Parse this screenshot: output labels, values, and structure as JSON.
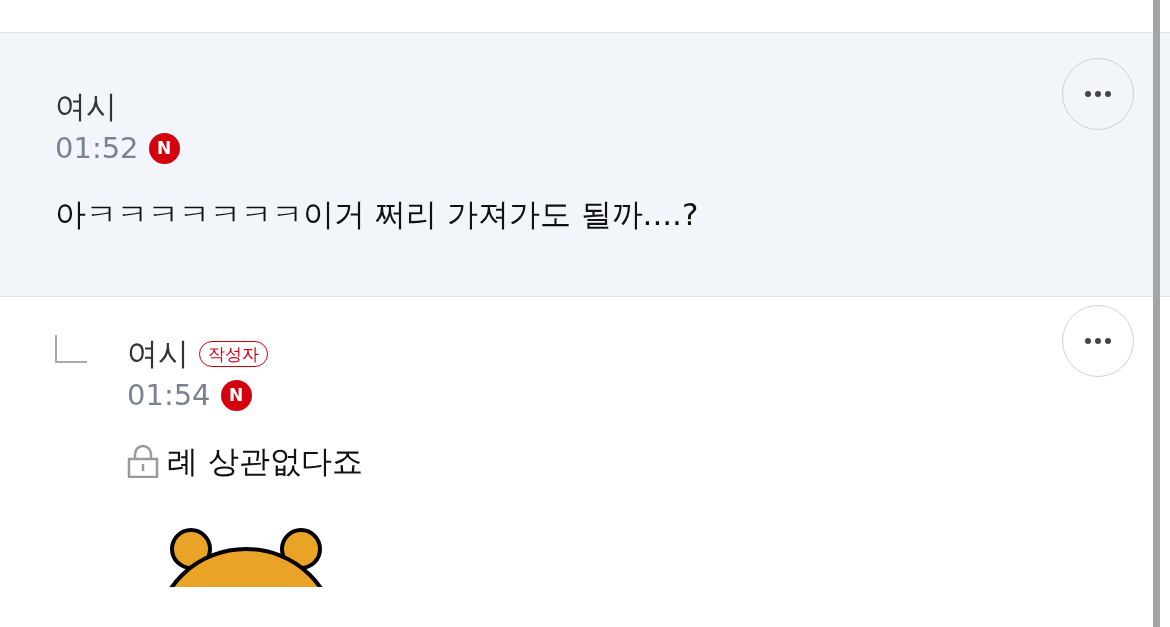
{
  "comments": [
    {
      "kind": "comment",
      "author": "여시",
      "time": "01:52",
      "new_badge": "N",
      "highlighted": true,
      "secret": false,
      "text": "아ㅋㅋㅋㅋㅋㅋㅋ이거 쩌리 가져가도 될까....?",
      "sticker": false
    },
    {
      "kind": "reply",
      "author": "여시",
      "author_badge": "작성자",
      "time": "01:54",
      "new_badge": "N",
      "highlighted": false,
      "secret": true,
      "text": "례 상관없다죠",
      "sticker": true
    }
  ]
}
